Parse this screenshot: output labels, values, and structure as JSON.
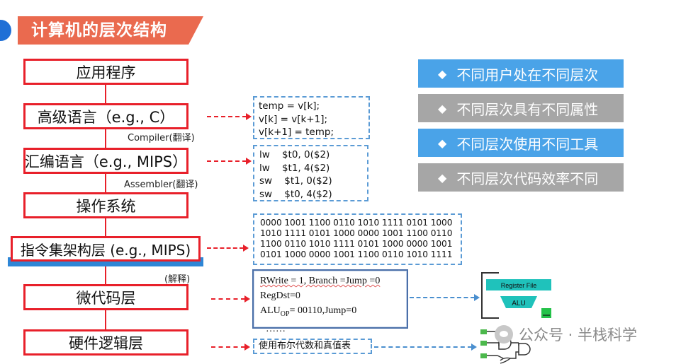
{
  "title": "计算机的层次结构",
  "layers": [
    {
      "id": "app",
      "label": "应用程序"
    },
    {
      "id": "hll",
      "label": "高级语言（e.g., C）"
    },
    {
      "id": "asm",
      "label": "汇编语言（e.g., MIPS）"
    },
    {
      "id": "os",
      "label": "操作系统"
    },
    {
      "id": "isa",
      "label": "指令集架构层 (e.g., MIPS)"
    },
    {
      "id": "micro",
      "label": "微代码层"
    },
    {
      "id": "hw",
      "label": "硬件逻辑层"
    }
  ],
  "transitions": {
    "compiler": "Compiler(翻译)",
    "assembler": "Assembler(翻译)",
    "interpret": "(解释)"
  },
  "code_c": [
    "temp = v[k];",
    "v[k] = v[k+1];",
    "v[k+1] = temp;"
  ],
  "code_mips": [
    "lw    $t0, 0($2)",
    "lw    $t1, 4($2)",
    "sw    $t1, 0($2)",
    "sw    $t0, 4($2)"
  ],
  "code_binary": [
    "0000 1001 1100 0110 1010 1111 0101 1000",
    "1010 1111 0101 1000 0000 1001 1100 0110",
    "1100 0110 1010 1111 0101 1000 0000 1001",
    "0101 1000 0000 1001 1100 0110 1010 1111"
  ],
  "microcode": {
    "line1": "RWrite = 1, Branch =Jump =0",
    "line2": "RegDst=0",
    "line3_prefix": "ALU",
    "line3_sub": "OP",
    "line3_suffix": "= 00110,Jump=0",
    "line4": "……"
  },
  "boolean_note": "使用布尔代数和真值表",
  "properties": [
    {
      "text": "不同用户处在不同层次",
      "color": "#4aa3e8"
    },
    {
      "text": "不同层次具有不同属性",
      "color": "#a6a6a6"
    },
    {
      "text": "不同层次使用不同工具",
      "color": "#4aa3e8"
    },
    {
      "text": "不同层次代码效率不同",
      "color": "#a6a6a6"
    }
  ],
  "bullet_symbol": "◆",
  "datapath": {
    "register_file": "Register File",
    "alu": "ALU"
  },
  "watermark": "公众号 · 半栈科学"
}
